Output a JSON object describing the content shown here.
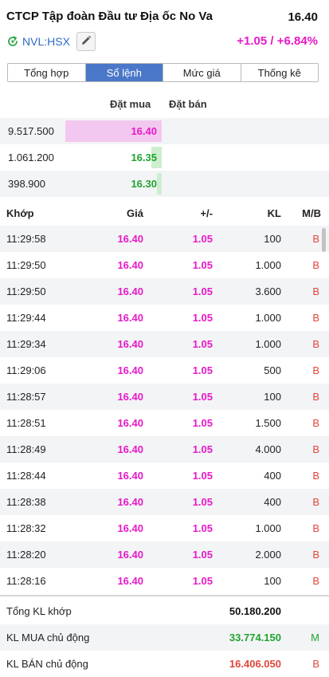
{
  "header": {
    "company_name": "CTCP Tập đoàn Đầu tư Địa ốc No Va",
    "last_price": "16.40",
    "ticker": "NVL:HSX",
    "change": "+1.05 / +6.84%"
  },
  "tabs": [
    {
      "label": "Tổng hợp",
      "active": false
    },
    {
      "label": "Sổ lệnh",
      "active": true
    },
    {
      "label": "Mức giá",
      "active": false
    },
    {
      "label": "Thống kê",
      "active": false
    }
  ],
  "orderbook": {
    "buy_header": "Đặt mua",
    "sell_header": "Đặt bán",
    "rows": [
      {
        "volume": "9.517.500",
        "price": "16.40",
        "price_color": "#e619c8",
        "bar_color": "#f3c8f0",
        "bar_fraction": 1.0
      },
      {
        "volume": "1.061.200",
        "price": "16.35",
        "price_color": "#1fa42f",
        "bar_color": "#cdeecf",
        "bar_fraction": 0.11
      },
      {
        "volume": "398.900",
        "price": "16.30",
        "price_color": "#1fa42f",
        "bar_color": "#cdeecf",
        "bar_fraction": 0.04
      }
    ]
  },
  "trades": {
    "headers": {
      "time": "Khớp",
      "price": "Giá",
      "change": "+/-",
      "volume": "KL",
      "side": "M/B"
    },
    "rows": [
      {
        "time": "11:29:58",
        "price": "16.40",
        "change": "1.05",
        "volume": "100",
        "side": "B"
      },
      {
        "time": "11:29:50",
        "price": "16.40",
        "change": "1.05",
        "volume": "1.000",
        "side": "B"
      },
      {
        "time": "11:29:50",
        "price": "16.40",
        "change": "1.05",
        "volume": "3.600",
        "side": "B"
      },
      {
        "time": "11:29:44",
        "price": "16.40",
        "change": "1.05",
        "volume": "1.000",
        "side": "B"
      },
      {
        "time": "11:29:34",
        "price": "16.40",
        "change": "1.05",
        "volume": "1.000",
        "side": "B"
      },
      {
        "time": "11:29:06",
        "price": "16.40",
        "change": "1.05",
        "volume": "500",
        "side": "B"
      },
      {
        "time": "11:28:57",
        "price": "16.40",
        "change": "1.05",
        "volume": "100",
        "side": "B"
      },
      {
        "time": "11:28:51",
        "price": "16.40",
        "change": "1.05",
        "volume": "1.500",
        "side": "B"
      },
      {
        "time": "11:28:49",
        "price": "16.40",
        "change": "1.05",
        "volume": "4.000",
        "side": "B"
      },
      {
        "time": "11:28:44",
        "price": "16.40",
        "change": "1.05",
        "volume": "400",
        "side": "B"
      },
      {
        "time": "11:28:38",
        "price": "16.40",
        "change": "1.05",
        "volume": "400",
        "side": "B"
      },
      {
        "time": "11:28:32",
        "price": "16.40",
        "change": "1.05",
        "volume": "1.000",
        "side": "B"
      },
      {
        "time": "11:28:20",
        "price": "16.40",
        "change": "1.05",
        "volume": "2.000",
        "side": "B"
      },
      {
        "time": "11:28:16",
        "price": "16.40",
        "change": "1.05",
        "volume": "100",
        "side": "B"
      }
    ]
  },
  "summary": {
    "rows": [
      {
        "label": "Tổng KL khớp",
        "value": "50.180.200",
        "value_color": "#111111",
        "side": "",
        "side_color": "#111111"
      },
      {
        "label": "KL MUA chủ động",
        "value": "33.774.150",
        "value_color": "#1fa42f",
        "side": "M",
        "side_color": "#1fa42f"
      },
      {
        "label": "KL BÁN chủ động",
        "value": "16.406.050",
        "value_color": "#e0453b",
        "side": "B",
        "side_color": "#e0453b"
      }
    ]
  },
  "colors": {
    "accent": "#4a77c8",
    "ceiling_magenta": "#e619c8",
    "up_green": "#1fa42f",
    "down_red": "#e0453b",
    "ticker_blue": "#2e6bc6",
    "stripe": "#f3f4f6"
  },
  "icons": {
    "status": "sync-icon",
    "edit": "pencil-icon"
  }
}
